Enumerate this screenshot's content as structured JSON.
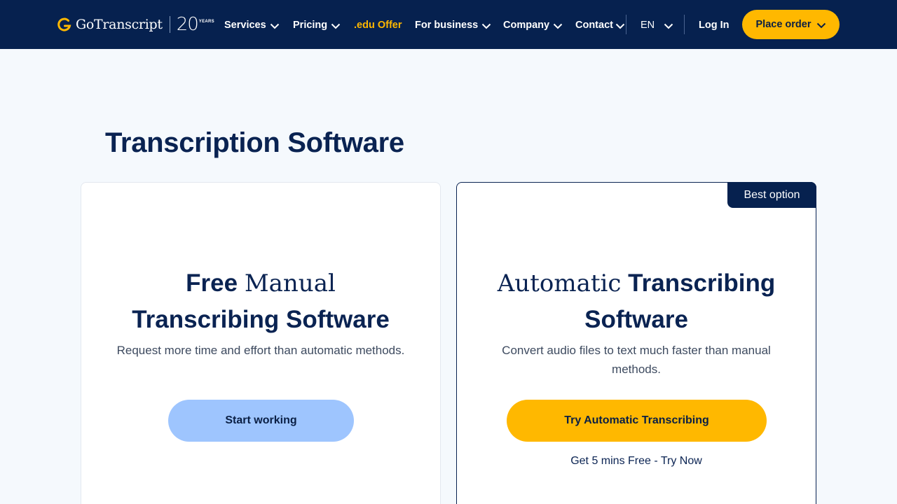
{
  "header": {
    "logo_text": "GoTranscript",
    "logo_years_number": "20",
    "logo_years_label": "YEARS",
    "nav": [
      {
        "label": "Services"
      },
      {
        "label": "Pricing"
      },
      {
        "label": ".edu Offer"
      },
      {
        "label": "For business"
      },
      {
        "label": "Company"
      },
      {
        "label": "Contact"
      }
    ],
    "language": "EN",
    "login_label": "Log In",
    "place_order_label": "Place order",
    "colors": {
      "background": "#06214f",
      "accent": "#ffb800"
    }
  },
  "main": {
    "title": "Transcription Software",
    "cards": [
      {
        "title_word1": "Free",
        "title_word2": "Manual",
        "title_line2": "Transcribing Software",
        "description": "Request more time and effort than automatic methods.",
        "button_label": "Start working"
      },
      {
        "badge": "Best option",
        "title_word1": "Automatic",
        "title_word2": "Transcribing",
        "title_line2": "Software",
        "description": "Convert audio files to text much faster than manual methods.",
        "button_label": "Try Automatic Transcribing",
        "link_label": "Get 5 mins Free - Try Now"
      }
    ]
  },
  "icons": {
    "logo": "gotranscript-g-icon",
    "dropdown": "chevron-down-icon"
  }
}
